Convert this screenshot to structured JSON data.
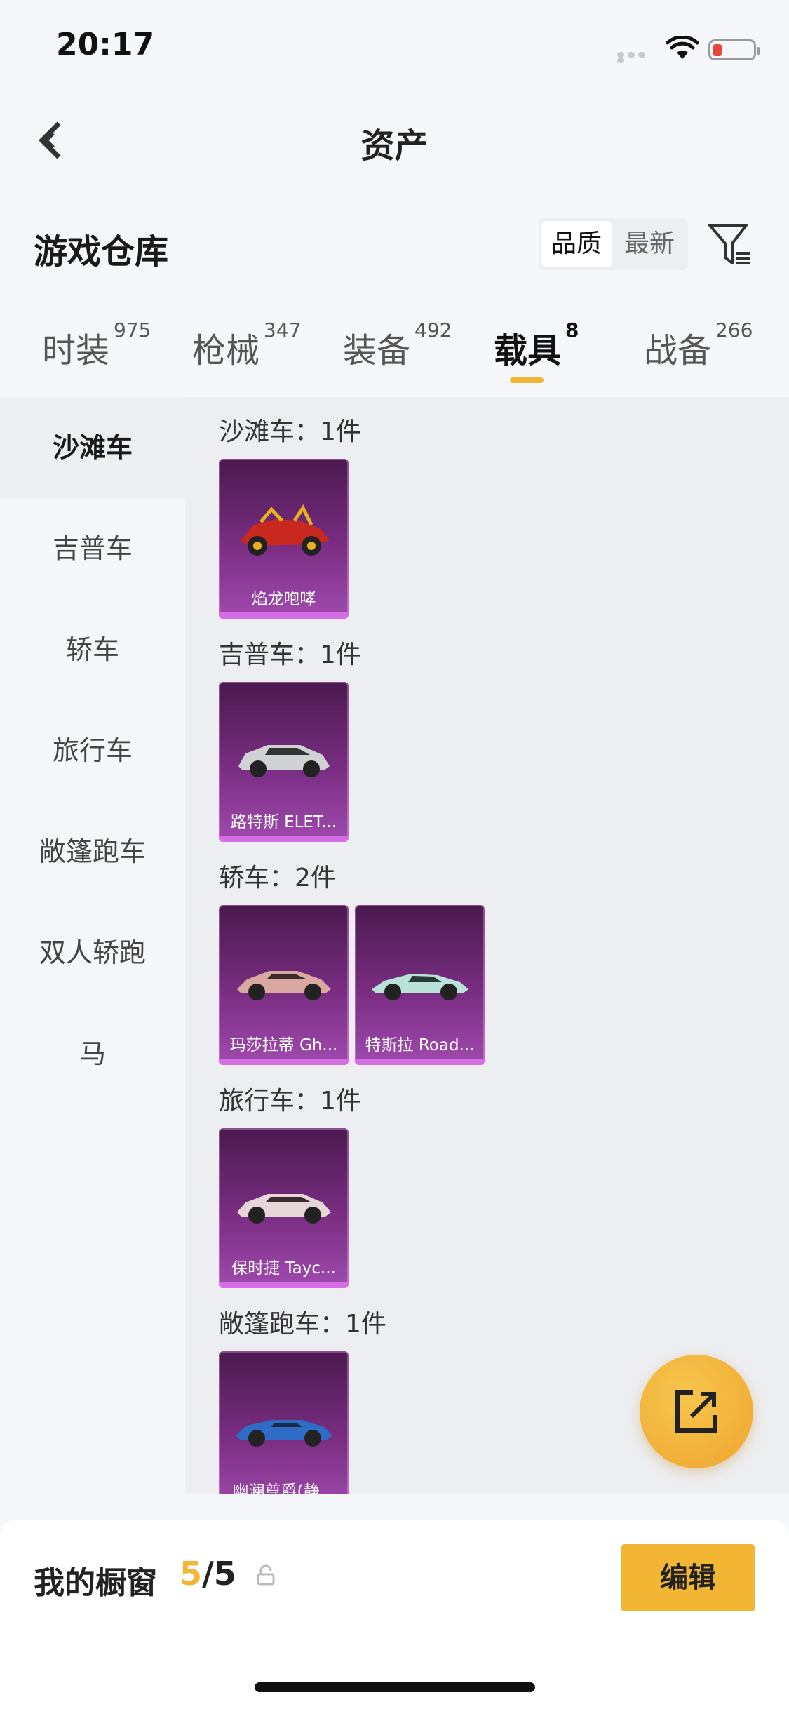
{
  "status_bar": {
    "time": "20:17"
  },
  "nav": {
    "title": "资产"
  },
  "warehouse": {
    "title": "游戏仓库",
    "sort_options": [
      "品质",
      "最新"
    ],
    "sort_selected": "品质"
  },
  "tabs": [
    {
      "label": "时装",
      "count": "975",
      "active": false
    },
    {
      "label": "枪械",
      "count": "347",
      "active": false
    },
    {
      "label": "装备",
      "count": "492",
      "active": false
    },
    {
      "label": "载具",
      "count": "8",
      "active": true
    },
    {
      "label": "战备",
      "count": "266",
      "active": false
    }
  ],
  "sidebar": {
    "items": [
      {
        "label": "沙滩车",
        "active": true
      },
      {
        "label": "吉普车",
        "active": false
      },
      {
        "label": "轿车",
        "active": false
      },
      {
        "label": "旅行车",
        "active": false
      },
      {
        "label": "敞篷跑车",
        "active": false
      },
      {
        "label": "双人轿跑",
        "active": false
      },
      {
        "label": "马",
        "active": false
      }
    ]
  },
  "sections": [
    {
      "header": "沙滩车：1件",
      "items": [
        {
          "name": "焰龙咆哮",
          "icon": "buggy-icon",
          "color": "#c8281e"
        }
      ]
    },
    {
      "header": "吉普车：1件",
      "items": [
        {
          "name": "路特斯 ELET...",
          "icon": "suv-icon",
          "color": "#cfd1d4"
        }
      ]
    },
    {
      "header": "轿车：2件",
      "items": [
        {
          "name": "玛莎拉蒂 Gh...",
          "icon": "sedan-icon",
          "color": "#d9a8a0"
        },
        {
          "name": "特斯拉 Road...",
          "icon": "roadster-icon",
          "color": "#b9e3d8"
        }
      ]
    },
    {
      "header": "旅行车：1件",
      "items": [
        {
          "name": "保时捷 Tayc...",
          "icon": "wagon-icon",
          "color": "#e6d6d8"
        }
      ]
    },
    {
      "header": "敞篷跑车：1件",
      "items": [
        {
          "name": "幽澜尊爵(静...",
          "icon": "convertible-icon",
          "color": "#2f6cc8"
        }
      ]
    }
  ],
  "showcase": {
    "label": "我的橱窗",
    "current": "5",
    "total": "/5",
    "edit_label": "编辑"
  },
  "colors": {
    "accent": "#f2b534",
    "card_purple": "#7a2e83"
  }
}
